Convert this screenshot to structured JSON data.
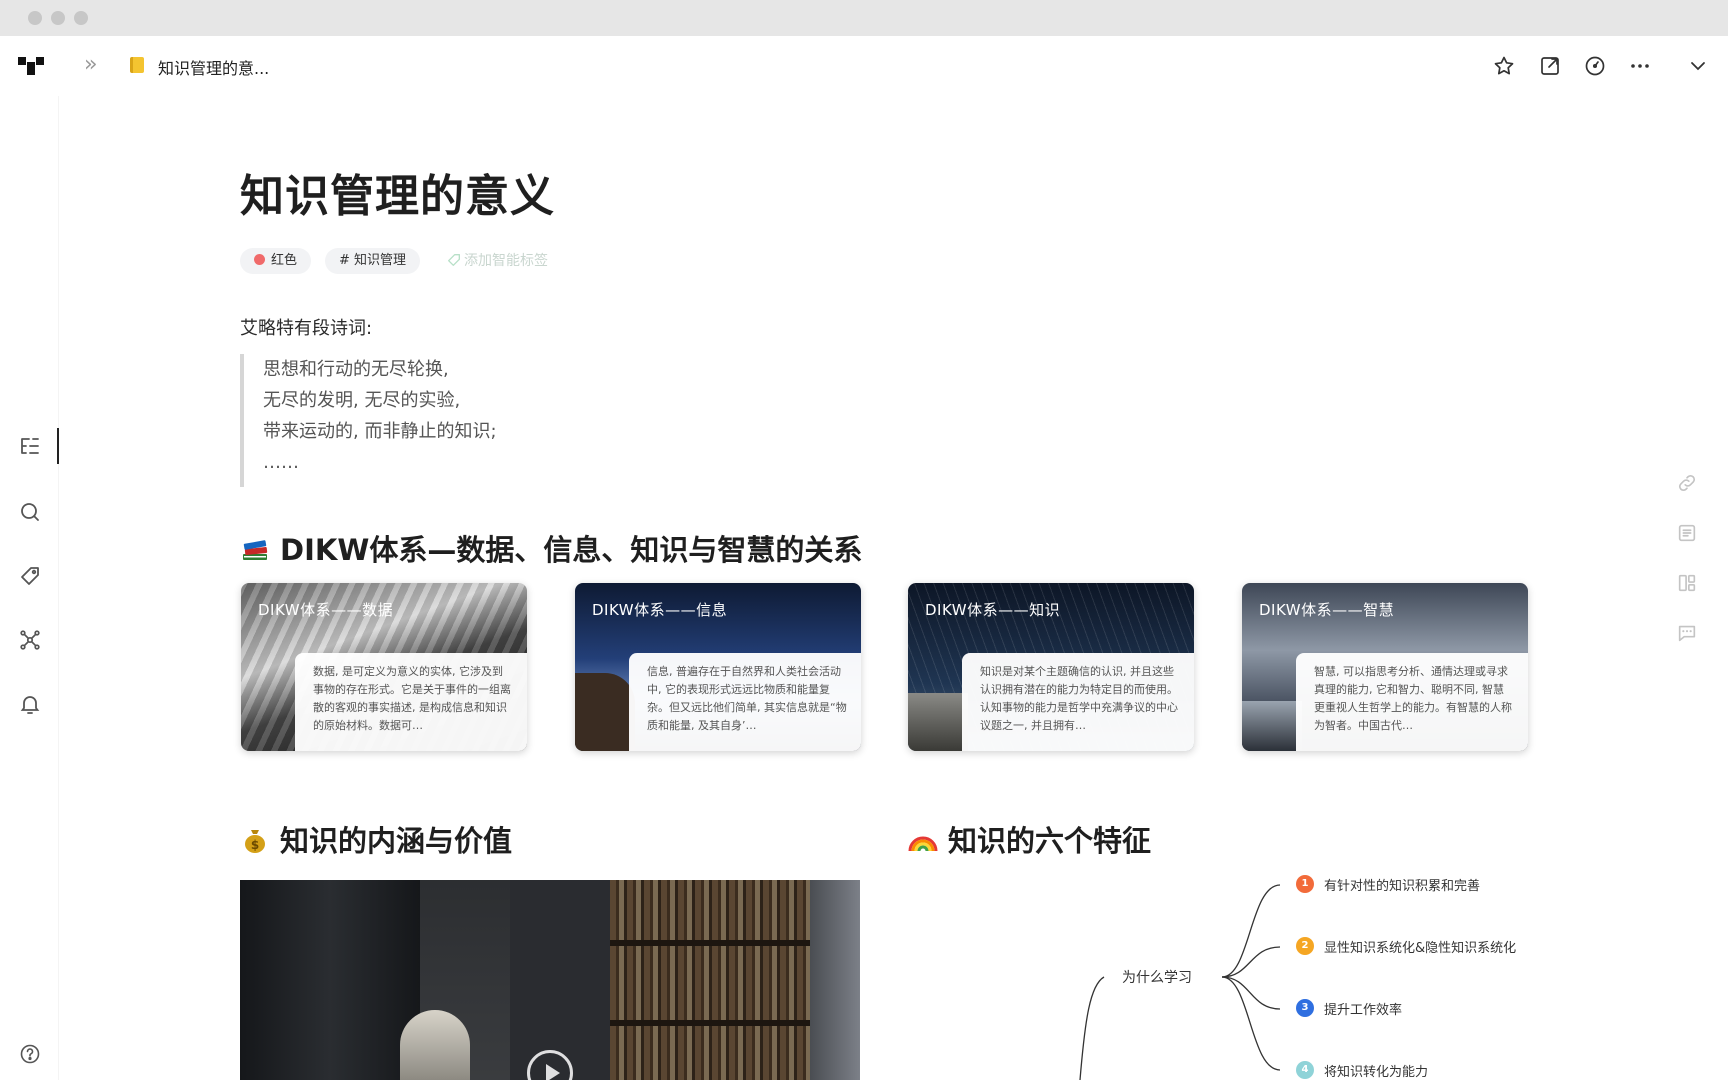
{
  "topbar": {
    "breadcrumb_title": "知识管理的意...",
    "icons": [
      "star-icon",
      "external-link-icon",
      "history-icon",
      "more-icon",
      "chevron-down-icon"
    ]
  },
  "sidebar": {
    "icons": [
      "outline-icon",
      "search-icon",
      "tag-icon",
      "graph-icon",
      "bell-icon",
      "help-icon"
    ]
  },
  "right_rail": {
    "icons": [
      "link-icon",
      "list-icon",
      "layout-icon",
      "comment-icon"
    ]
  },
  "doc": {
    "title": "知识管理的意义",
    "tags": [
      {
        "label": "红色",
        "color": "#f06a6a"
      },
      {
        "label": "#  知识管理"
      }
    ],
    "add_tag_label": "添加智能标签",
    "intro": "艾略特有段诗词:",
    "quote": [
      "思想和行动的无尽轮换,",
      "无尽的发明, 无尽的实验,",
      "带来运动的, 而非静止的知识;",
      "……"
    ]
  },
  "sections": {
    "dikw": {
      "emoji": "books-emoji",
      "title": "DIKW体系—数据、信息、知识与智慧的关系"
    },
    "value": {
      "emoji": "money-bag-emoji",
      "title": "知识的内涵与价值"
    },
    "features": {
      "emoji": "rainbow-emoji",
      "title": "知识的六个特征"
    }
  },
  "cards": [
    {
      "title": "DIKW体系——数据",
      "text": "数据, 是可定义为意义的实体, 它涉及到事物的存在形式。它是关于事件的一组离散的客观的事实描述, 是构成信息和知识的原始材料。数据可…"
    },
    {
      "title": "DIKW体系——信息",
      "text": "信息, 普遍存在于自然界和人类社会活动中, 它的表现形式远远比物质和能量复杂。但又远比他们简单, 其实信息就是“物质和能量, 及其自身’…"
    },
    {
      "title": "DIKW体系——知识",
      "text": "知识是对某个主题确信的认识, 并且这些认识拥有潜在的能力为特定目的而使用。认知事物的能力是哲学中充满争议的中心议题之一, 并且拥有…"
    },
    {
      "title": "DIKW体系——智慧",
      "text": "智慧, 可以指思考分析、通情达理或寻求真理的能力, 它和智力、聪明不同, 智慧更重视人生哲学上的能力。有智慧的人称为智者。中国古代…"
    }
  ],
  "mindmap": {
    "root": "为什么学习",
    "nodes": [
      {
        "num": "1",
        "label": "有针对性的知识积累和完善",
        "color": "#f26b3a"
      },
      {
        "num": "2",
        "label": "显性知识系统化&隐性知识系统化",
        "color": "#f5a623"
      },
      {
        "num": "3",
        "label": "提升工作效率",
        "color": "#2f6fe0"
      },
      {
        "num": "4",
        "label": "将知识转化为能力",
        "color": "#8fd3d8"
      }
    ]
  },
  "colors": {
    "accent_red": "#f06a6a",
    "tag_bg": "#f2f3f5"
  }
}
